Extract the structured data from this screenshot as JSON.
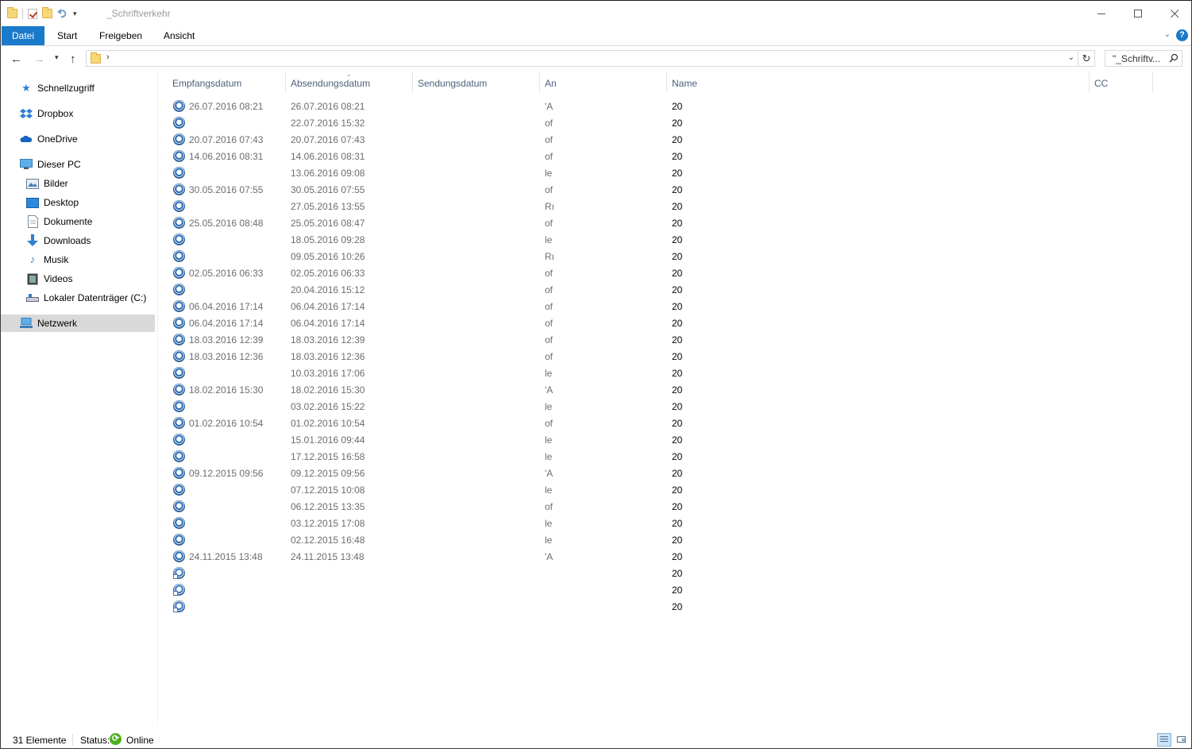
{
  "window": {
    "title": "_Schriftverkehr",
    "controls": [
      "minimize-icon",
      "maximize-icon",
      "close-icon"
    ]
  },
  "ribbon": {
    "tabs": [
      "Datei",
      "Start",
      "Freigeben",
      "Ansicht"
    ],
    "active_tab": "Datei",
    "accent": "#1979ca"
  },
  "navbar": {
    "address_separator": "›",
    "search_placeholder": "\"_Schriftv...",
    "icons": [
      "back-arrow-icon",
      "forward-arrow-icon",
      "recent-dropdown-icon",
      "up-arrow-icon",
      "refresh-icon",
      "search-icon"
    ]
  },
  "sidebar": {
    "items": [
      {
        "label": "Schnellzugriff",
        "icon": "star-icon"
      },
      {
        "label": "Dropbox",
        "icon": "dropbox-icon"
      },
      {
        "label": "OneDrive",
        "icon": "cloud-icon"
      },
      {
        "label": "Dieser PC",
        "icon": "computer-icon"
      },
      {
        "label": "Bilder",
        "icon": "pictures-icon"
      },
      {
        "label": "Desktop",
        "icon": "desktop-icon"
      },
      {
        "label": "Dokumente",
        "icon": "documents-icon"
      },
      {
        "label": "Downloads",
        "icon": "download-icon"
      },
      {
        "label": "Musik",
        "icon": "music-icon"
      },
      {
        "label": "Videos",
        "icon": "video-icon"
      },
      {
        "label": "Lokaler Datenträger (C:)",
        "icon": "drive-icon"
      },
      {
        "label": "Netzwerk",
        "icon": "network-icon"
      }
    ],
    "selected": "Netzwerk"
  },
  "columns": [
    "Empfangsdatum",
    "Absendungsdatum",
    "Sendungsdatum",
    "An",
    "Name",
    "CC"
  ],
  "sorted_column": "Absendungsdatum",
  "rows": [
    {
      "empfang": "26.07.2016 08:21",
      "absend": "26.07.2016 08:21",
      "an": "'A",
      "name": "20"
    },
    {
      "empfang": "",
      "absend": "22.07.2016 15:32",
      "an": "of",
      "name": "20"
    },
    {
      "empfang": "20.07.2016 07:43",
      "absend": "20.07.2016 07:43",
      "an": "of",
      "name": "20"
    },
    {
      "empfang": "14.06.2016 08:31",
      "absend": "14.06.2016 08:31",
      "an": "of",
      "name": "20"
    },
    {
      "empfang": "",
      "absend": "13.06.2016 09:08",
      "an": "le",
      "name": "20"
    },
    {
      "empfang": "30.05.2016 07:55",
      "absend": "30.05.2016 07:55",
      "an": "of",
      "name": "20"
    },
    {
      "empfang": "",
      "absend": "27.05.2016 13:55",
      "an": "Rı",
      "name": "20"
    },
    {
      "empfang": "25.05.2016 08:48",
      "absend": "25.05.2016 08:47",
      "an": "of",
      "name": "20"
    },
    {
      "empfang": "",
      "absend": "18.05.2016 09:28",
      "an": "le",
      "name": "20"
    },
    {
      "empfang": "",
      "absend": "09.05.2016 10:26",
      "an": "Rı",
      "name": "20"
    },
    {
      "empfang": "02.05.2016 06:33",
      "absend": "02.05.2016 06:33",
      "an": "of",
      "name": "20"
    },
    {
      "empfang": "",
      "absend": "20.04.2016 15:12",
      "an": "of",
      "name": "20"
    },
    {
      "empfang": "06.04.2016 17:14",
      "absend": "06.04.2016 17:14",
      "an": "of",
      "name": "20"
    },
    {
      "empfang": "06.04.2016 17:14",
      "absend": "06.04.2016 17:14",
      "an": "of",
      "name": "20"
    },
    {
      "empfang": "18.03.2016 12:39",
      "absend": "18.03.2016 12:39",
      "an": "of",
      "name": "20"
    },
    {
      "empfang": "18.03.2016 12:36",
      "absend": "18.03.2016 12:36",
      "an": "of",
      "name": "20"
    },
    {
      "empfang": "",
      "absend": "10.03.2016 17:06",
      "an": "le",
      "name": "20"
    },
    {
      "empfang": "18.02.2016 15:30",
      "absend": "18.02.2016 15:30",
      "an": "'A",
      "name": "20"
    },
    {
      "empfang": "",
      "absend": "03.02.2016 15:22",
      "an": "le",
      "name": "20"
    },
    {
      "empfang": "01.02.2016 10:54",
      "absend": "01.02.2016 10:54",
      "an": "of",
      "name": "20"
    },
    {
      "empfang": "",
      "absend": "15.01.2016 09:44",
      "an": "le",
      "name": "20"
    },
    {
      "empfang": "",
      "absend": "17.12.2015 16:58",
      "an": "le",
      "name": "20"
    },
    {
      "empfang": "09.12.2015 09:56",
      "absend": "09.12.2015 09:56",
      "an": "'A",
      "name": "20"
    },
    {
      "empfang": "",
      "absend": "07.12.2015 10:08",
      "an": "le",
      "name": "20"
    },
    {
      "empfang": "",
      "absend": "06.12.2015 13:35",
      "an": "of",
      "name": "20"
    },
    {
      "empfang": "",
      "absend": "03.12.2015 17:08",
      "an": "le",
      "name": "20"
    },
    {
      "empfang": "",
      "absend": "02.12.2015 16:48",
      "an": "le",
      "name": "20"
    },
    {
      "empfang": "24.11.2015 13:48",
      "absend": "24.11.2015 13:48",
      "an": "'A",
      "name": "20"
    },
    {
      "empfang": "",
      "absend": "",
      "an": "",
      "name": "20",
      "icon": "mail-shortcut-icon"
    },
    {
      "empfang": "",
      "absend": "",
      "an": "",
      "name": "20",
      "icon": "mail-shortcut-icon"
    },
    {
      "empfang": "",
      "absend": "",
      "an": "",
      "name": "20",
      "icon": "mail-shortcut-icon"
    }
  ],
  "status": {
    "count": "31 Elemente",
    "status_label": "Status:",
    "status_value": "Online",
    "status_color": "#4caf1e"
  }
}
